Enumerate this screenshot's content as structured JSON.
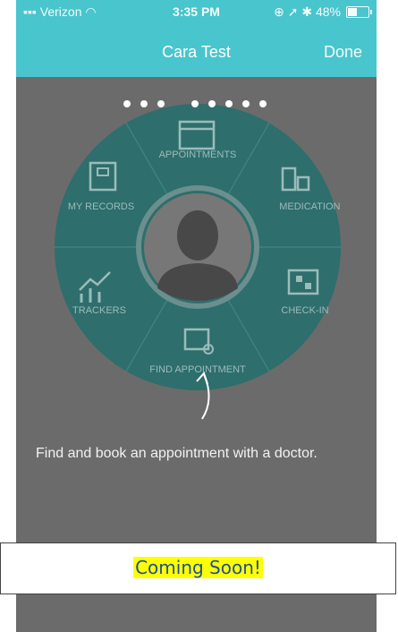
{
  "status_bar": {
    "carrier": "Verizon",
    "time": "3:35 PM",
    "battery_percent": "48%",
    "icons": [
      "signal-icon",
      "wifi-icon",
      "lock-rotation-icon",
      "location-icon",
      "bluetooth-icon",
      "battery-icon"
    ]
  },
  "nav": {
    "title": "Cara Test",
    "done_label": "Done"
  },
  "wheel": {
    "segments": [
      {
        "label": "APPOINTMENTS",
        "icon": "calendar-icon"
      },
      {
        "label": "MEDICATIONS",
        "icon": "pill-bottles-icon"
      },
      {
        "label": "CHECK-IN",
        "icon": "qr-code-icon"
      },
      {
        "label": "FIND APPOINTMENT",
        "icon": "calendar-search-icon"
      },
      {
        "label": "TRACKERS",
        "icon": "chart-trend-icon"
      },
      {
        "label": "MY RECORDS",
        "icon": "hospital-icon"
      }
    ],
    "center_icon": "user-avatar-icon",
    "highlighted": "FIND APPOINTMENT"
  },
  "page_dots": {
    "count": 8,
    "current": 4
  },
  "hint": "Find and book an appointment with a doctor.",
  "banner": "Coming Soon!",
  "colors": {
    "accent": "#49c5cd",
    "wheel": "#2e6e6c",
    "overlay": "#6b6b6b",
    "highlight": "#ffff00"
  }
}
